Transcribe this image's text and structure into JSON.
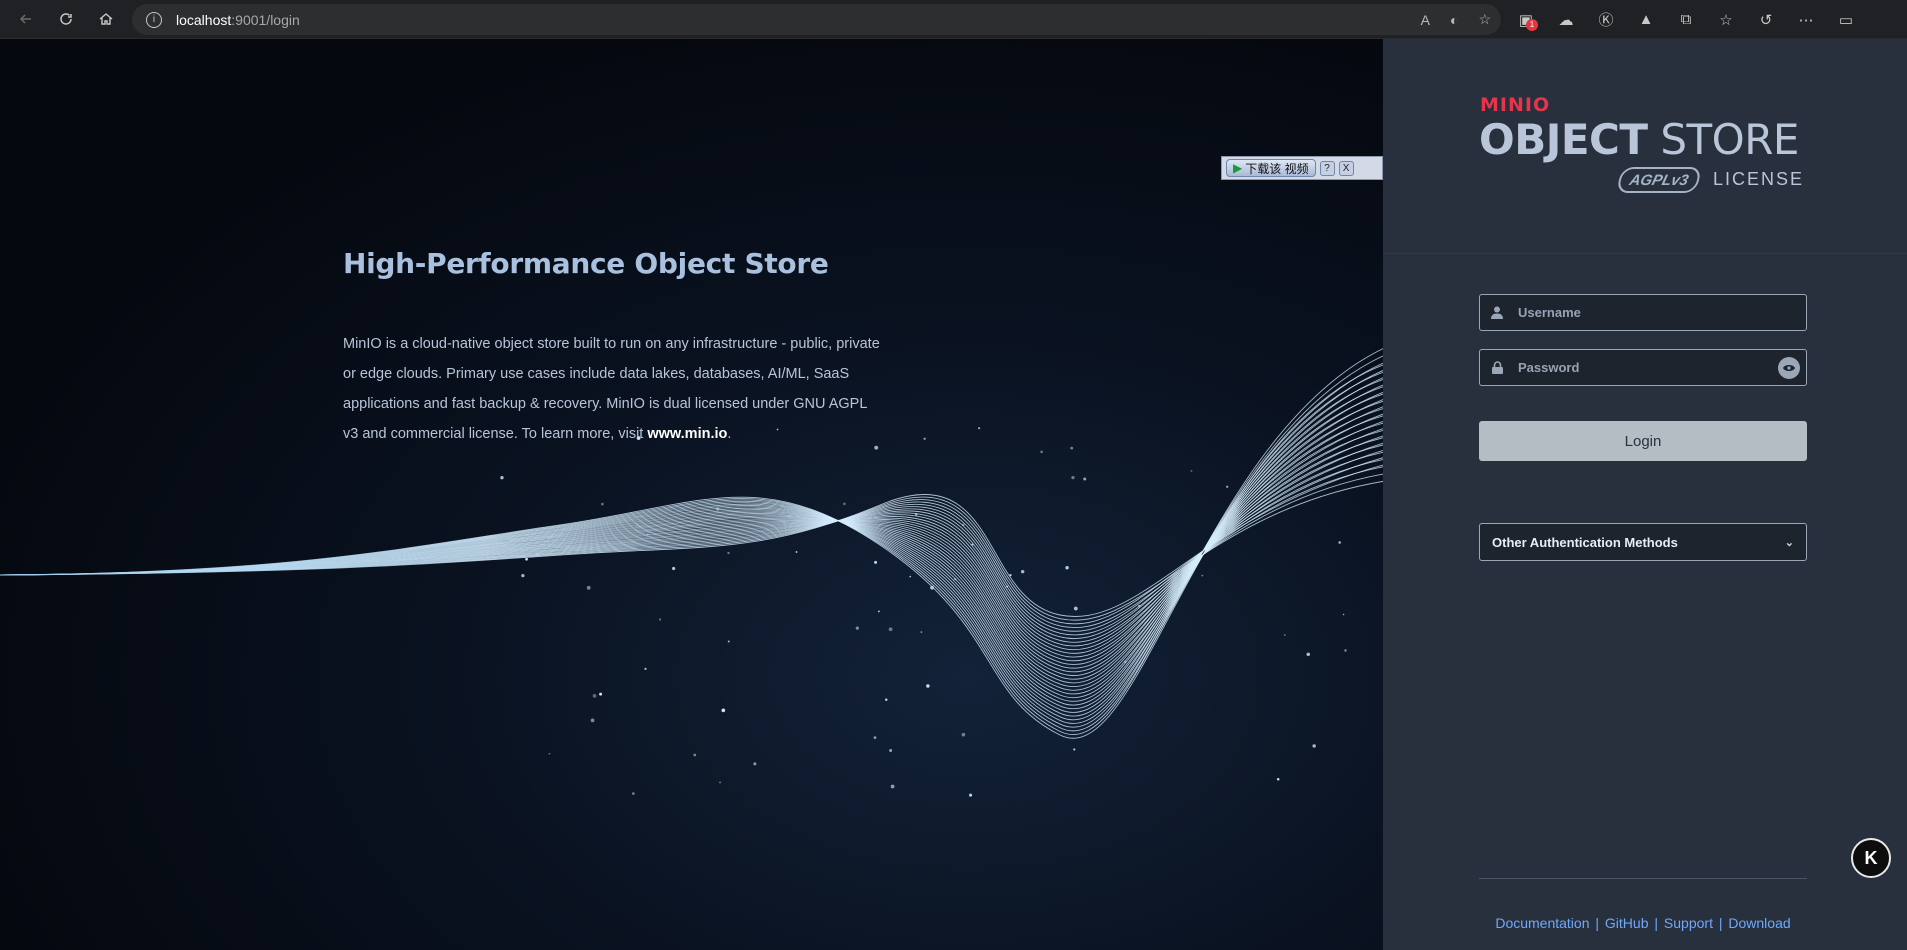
{
  "browser": {
    "url_host": "localhost",
    "url_rest": ":9001/login"
  },
  "hero": {
    "title": "High-Performance Object Store",
    "text": "MinIO is a cloud-native object store built to run on any infrastructure - public, private or edge clouds. Primary use cases include data lakes, databases, AI/ML, SaaS applications and fast backup & recovery. MinIO is dual licensed under GNU AGPL v3 and commercial license. To learn more, visit ",
    "link": "www.min.io",
    "text_end": "."
  },
  "download_widget": {
    "label": "下载该 视频",
    "help": "?",
    "close": "X"
  },
  "logo": {
    "brand": "MINIO",
    "product_bold": "OBJECT",
    "product_light": " STORE",
    "badge": "AGPLv3",
    "license": "LICENSE"
  },
  "form": {
    "username_placeholder": "Username",
    "password_placeholder": "Password",
    "login_label": "Login",
    "other_auth_label": "Other Authentication Methods"
  },
  "footer": {
    "links": [
      "Documentation",
      "GitHub",
      "Support",
      "Download"
    ],
    "separator": "|"
  },
  "float_button": {
    "label": "K"
  },
  "colors": {
    "panel_bg": "#27303c",
    "accent_red": "#e6344a",
    "link_blue": "#6ea8ff"
  }
}
